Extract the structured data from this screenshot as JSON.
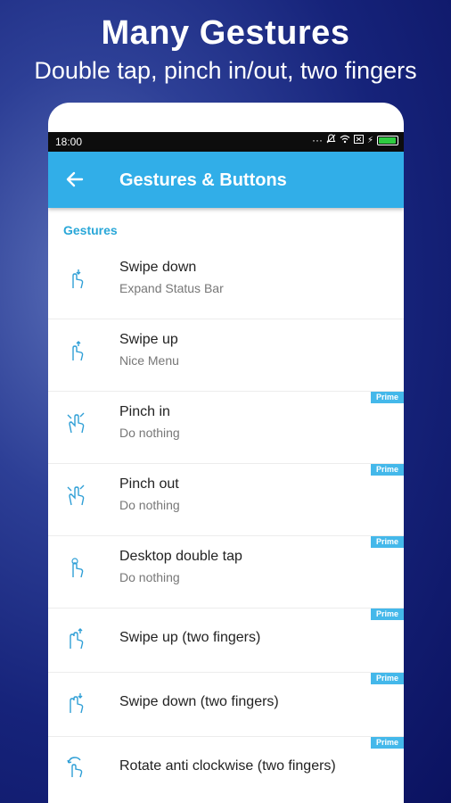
{
  "promo": {
    "title": "Many Gestures",
    "subtitle": "Double tap, pinch in/out, two fingers"
  },
  "status_bar": {
    "time": "18:00"
  },
  "toolbar": {
    "title": "Gestures & Buttons",
    "back_icon": "arrow-left-icon"
  },
  "section": {
    "header": "Gestures"
  },
  "items": [
    {
      "title": "Swipe down",
      "subtitle": "Expand Status Bar",
      "badge": "",
      "icon": "swipe-down-gesture-icon"
    },
    {
      "title": "Swipe up",
      "subtitle": "Nice Menu",
      "badge": "",
      "icon": "swipe-up-gesture-icon"
    },
    {
      "title": "Pinch in",
      "subtitle": "Do nothing",
      "badge": "Prime",
      "icon": "pinch-in-gesture-icon"
    },
    {
      "title": "Pinch out",
      "subtitle": "Do nothing",
      "badge": "Prime",
      "icon": "pinch-out-gesture-icon"
    },
    {
      "title": "Desktop double tap",
      "subtitle": "Do nothing",
      "badge": "Prime",
      "icon": "double-tap-gesture-icon"
    },
    {
      "title": "Swipe up (two fingers)",
      "badge": "Prime",
      "icon": "two-finger-swipe-up-icon"
    },
    {
      "title": "Swipe down (two fingers)",
      "badge": "Prime",
      "icon": "two-finger-swipe-down-icon"
    },
    {
      "title": "Rotate anti clockwise (two fingers)",
      "badge": "Prime",
      "icon": "rotate-gesture-icon"
    }
  ],
  "colors": {
    "accent": "#31aee8",
    "section": "#29a7d8",
    "badge": "#44b8ea"
  }
}
